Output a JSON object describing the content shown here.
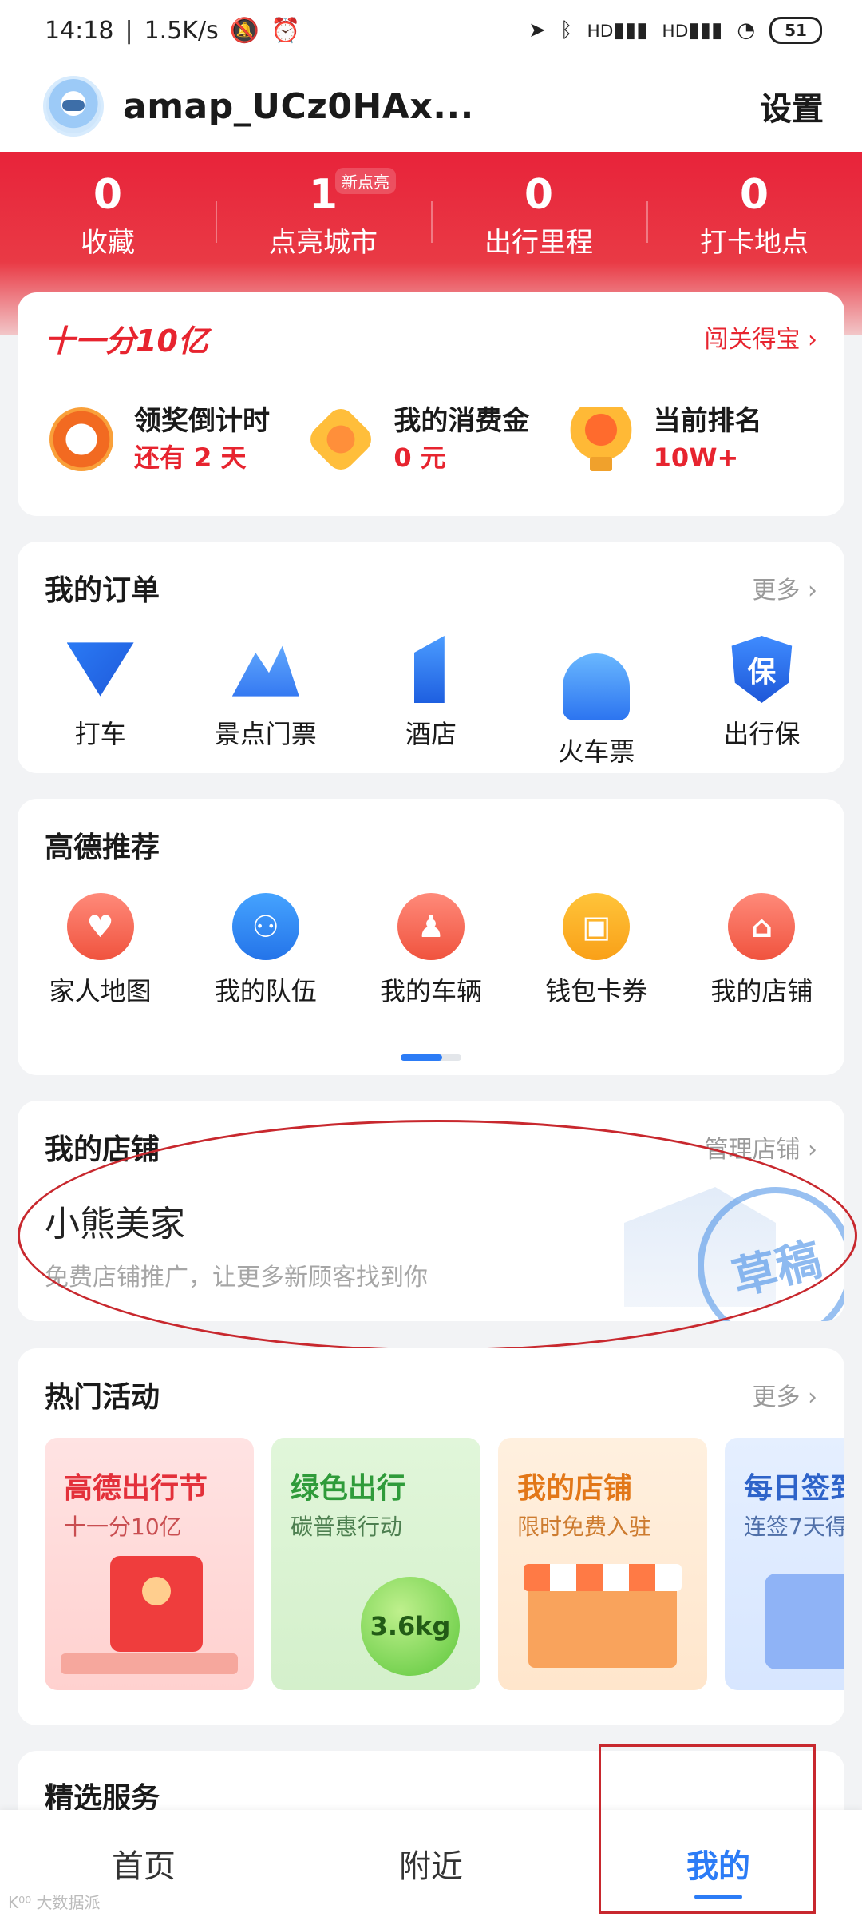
{
  "status_bar": {
    "time": "14:18",
    "speed": "1.5K/s",
    "battery": "51",
    "network": "HD"
  },
  "header": {
    "username": "amap_UCz0HAx...",
    "settings": "设置"
  },
  "stats": [
    {
      "value": "0",
      "label": "收藏",
      "badge": ""
    },
    {
      "value": "1",
      "label": "点亮城市",
      "badge": "新点亮"
    },
    {
      "value": "0",
      "label": "出行里程",
      "badge": ""
    },
    {
      "value": "0",
      "label": "打卡地点",
      "badge": ""
    }
  ],
  "promo": {
    "title": "十一分10亿",
    "link": "闯关得宝 ›",
    "items": [
      {
        "icon": "alarm-clock-icon",
        "title": "领奖倒计时",
        "value": "还有 2 天"
      },
      {
        "icon": "medal-icon",
        "title": "我的消费金",
        "value": "0 元"
      },
      {
        "icon": "trophy-icon",
        "title": "当前排名",
        "value": "10W+"
      }
    ]
  },
  "orders": {
    "title": "我的订单",
    "more": "更多 ›",
    "items": [
      {
        "icon": "taxi-icon",
        "label": "打车"
      },
      {
        "icon": "mountain-ticket-icon",
        "label": "景点门票"
      },
      {
        "icon": "hotel-icon",
        "label": "酒店"
      },
      {
        "icon": "train-icon",
        "label": "火车票"
      },
      {
        "icon": "shield-icon",
        "label": "出行保",
        "glyph": "保"
      }
    ]
  },
  "recommend": {
    "title": "高德推荐",
    "items": [
      {
        "icon": "family-heart-icon",
        "label": "家人地图",
        "glyph": "♥"
      },
      {
        "icon": "team-icon",
        "label": "我的队伍",
        "glyph": "⚇"
      },
      {
        "icon": "vehicle-icon",
        "label": "我的车辆",
        "glyph": "♟"
      },
      {
        "icon": "coupon-icon",
        "label": "钱包卡券",
        "glyph": "▣"
      },
      {
        "icon": "store-icon",
        "label": "我的店铺",
        "glyph": "⌂"
      }
    ]
  },
  "shop": {
    "title": "我的店铺",
    "manage": "管理店铺 ›",
    "name": "小熊美家",
    "desc": "免费店铺推广，让更多新顾客找到你",
    "stamp": "草稿"
  },
  "activities": {
    "title": "热门活动",
    "more": "更多 ›",
    "cards": [
      {
        "title": "高德出行节",
        "subtitle": "十一分10亿",
        "theme": "red"
      },
      {
        "title": "绿色出行",
        "subtitle": "碳普惠行动",
        "theme": "green",
        "badge": "3.6kg"
      },
      {
        "title": "我的店铺",
        "subtitle": "限时免费入驻",
        "theme": "orange"
      },
      {
        "title": "每日签到",
        "subtitle": "连签7天得",
        "theme": "blue"
      }
    ]
  },
  "selected": {
    "title": "精选服务"
  },
  "bottom_nav": [
    {
      "label": "首页",
      "active": false
    },
    {
      "label": "附近",
      "active": false
    },
    {
      "label": "我的",
      "active": true
    }
  ],
  "watermark": "K⁰⁰ 大数据派",
  "colors": {
    "brand_red": "#e7242f",
    "accent_blue": "#2c7cf6",
    "annotation_red": "#c8282e"
  }
}
